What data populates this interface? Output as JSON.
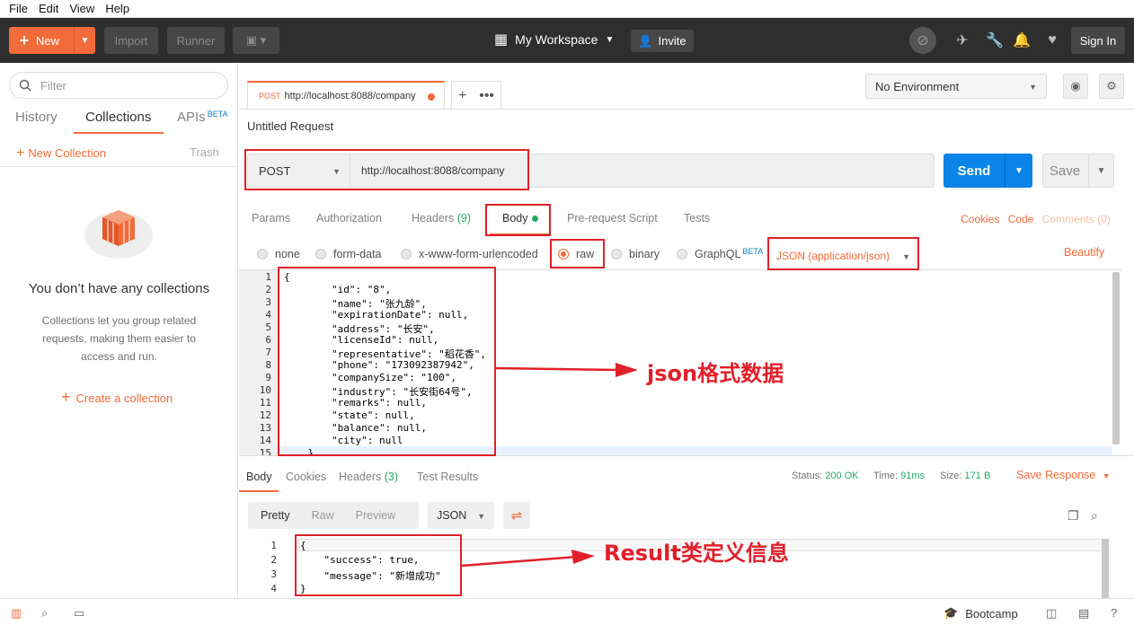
{
  "menu": [
    "File",
    "Edit",
    "View",
    "Help"
  ],
  "toolbar": {
    "new_label": "New",
    "import_label": "Import",
    "runner_label": "Runner",
    "workspace_label": "My Workspace",
    "invite_label": "Invite",
    "signin_label": "Sign In"
  },
  "sidebar": {
    "filter_placeholder": "Filter",
    "tabs": [
      "History",
      "Collections",
      "APIs"
    ],
    "apis_badge": "BETA",
    "new_collection": "New Collection",
    "trash": "Trash",
    "empty_title": "You don’t have any collections",
    "empty_desc": "Collections let you group related requests, making them easier to access and run.",
    "create_label": "Create a collection"
  },
  "request_tab": {
    "method": "POST",
    "url": "http://localhost:8088/company"
  },
  "environment": "No Environment",
  "request": {
    "title": "Untitled Request",
    "method": "POST",
    "url": "http://localhost:8088/company",
    "send_label": "Send",
    "save_label": "Save",
    "tabs": {
      "params": "Params",
      "authorization": "Authorization",
      "headers": "Headers",
      "headers_count": "(9)",
      "body": "Body",
      "prerequest": "Pre-request Script",
      "tests": "Tests"
    },
    "links": {
      "cookies": "Cookies",
      "code": "Code",
      "comments": "Comments (0)"
    },
    "body_types": [
      "none",
      "form-data",
      "x-www-form-urlencoded",
      "raw",
      "binary",
      "GraphQL"
    ],
    "graphql_badge": "BETA",
    "selected_body_type": "raw",
    "content_type": "JSON (application/json)",
    "beautify": "Beautify",
    "body_lines": [
      "{",
      "        \"id\": \"8\",",
      "        \"name\": \"张九龄\",",
      "        \"expirationDate\": null,",
      "        \"address\": \"长安\",",
      "        \"licenseId\": null,",
      "        \"representative\": \"稻花香\",",
      "        \"phone\": \"173092387942\",",
      "        \"companySize\": \"100\",",
      "        \"industry\": \"长安街64号\",",
      "        \"remarks\": null,",
      "        \"state\": null,",
      "        \"balance\": null,",
      "        \"city\": null",
      "    }"
    ]
  },
  "response": {
    "tabs": {
      "body": "Body",
      "cookies": "Cookies",
      "headers": "Headers",
      "headers_count": "(3)",
      "test_results": "Test Results"
    },
    "status_label": "Status:",
    "status_value": "200 OK",
    "time_label": "Time:",
    "time_value": "91ms",
    "size_label": "Size:",
    "size_value": "171 B",
    "save_response": "Save Response",
    "views": [
      "Pretty",
      "Raw",
      "Preview"
    ],
    "format": "JSON",
    "body_lines": [
      "{",
      "    \"success\": true,",
      "    \"message\": \"新增成功\"",
      "}"
    ]
  },
  "annotations": {
    "json_note": "json格式数据",
    "result_note": "Result类定义信息"
  },
  "footer": {
    "bootcamp": "Bootcamp"
  },
  "colors": {
    "accent": "#f26b3a",
    "send": "#0a84e6",
    "success": "#27a868",
    "annotation": "#e0202a"
  }
}
